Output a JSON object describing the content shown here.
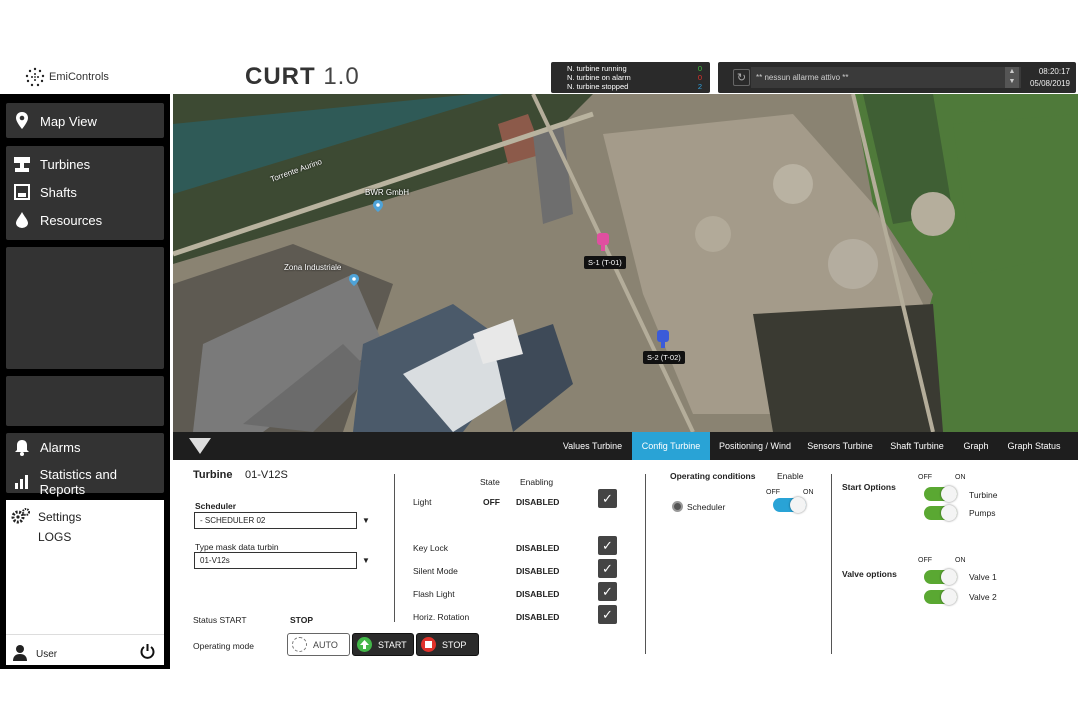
{
  "header": {
    "company": "EmiControls",
    "app_name": "CURT",
    "app_version": "1.0",
    "summary": [
      {
        "label": "N. turbine running",
        "value": "0",
        "color": "#3fbf3f"
      },
      {
        "label": "N. turbine on alarm",
        "value": "0",
        "color": "#e0322b"
      },
      {
        "label": "N. turbine stopped",
        "value": "2",
        "color": "#2fa3e0"
      }
    ],
    "alarm_text": "** nessun allarme attivo **",
    "time": "08:20:17",
    "date": "05/08/2019"
  },
  "sidebar": {
    "map_view": "Map View",
    "turbines": "Turbines",
    "shafts": "Shafts",
    "resources": "Resources",
    "alarms": "Alarms",
    "statistics": "Statistics and Reports",
    "settings": "Settings",
    "logs": "LOGS",
    "user": "User"
  },
  "map": {
    "labels": {
      "river": "Torrente Aurino",
      "bwr": "BWR GmbH",
      "zona": "Zona Industriale",
      "s1": "S-1 (T-01)",
      "s2": "S-2 (T-02)"
    }
  },
  "tabs": {
    "values_turbine": "Values Turbine",
    "config_turbine": "Config Turbine",
    "positioning_wind": "Positioning / Wind",
    "sensors_turbine": "Sensors Turbine",
    "shaft_turbine": "Shaft Turbine",
    "graph": "Graph",
    "graph_status": "Graph Status",
    "active": "Config Turbine"
  },
  "config": {
    "turbine_label": "Turbine",
    "turbine_value": "01-V12S",
    "scheduler_label": "Scheduler",
    "scheduler_value": "- SCHEDULER 02",
    "type_mask_label": "Type mask data turbin",
    "type_mask_value": "01-V12s",
    "status_label": "Status START",
    "status_value": "STOP",
    "operating_mode_label": "Operating mode",
    "buttons": {
      "auto": "AUTO",
      "start": "START",
      "stop": "STOP"
    },
    "state_header": "State",
    "enabling_header": "Enabling",
    "functions": [
      {
        "name": "Light",
        "state": "OFF",
        "enabling": "DISABLED"
      },
      {
        "name": "Key Lock",
        "state": "",
        "enabling": "DISABLED"
      },
      {
        "name": "Silent Mode",
        "state": "",
        "enabling": "DISABLED"
      },
      {
        "name": "Flash Light",
        "state": "",
        "enabling": "DISABLED"
      },
      {
        "name": "Horiz. Rotation",
        "state": "",
        "enabling": "DISABLED"
      }
    ],
    "operating_conditions": {
      "title": "Operating conditions",
      "enable_label": "Enable",
      "off": "OFF",
      "on": "ON",
      "scheduler": "Scheduler"
    },
    "start_options": {
      "title": "Start Options",
      "off": "OFF",
      "on": "ON",
      "items": [
        "Turbine",
        "Pumps"
      ]
    },
    "valve_options": {
      "title": "Valve options",
      "off": "OFF",
      "on": "ON",
      "items": [
        "Valve 1",
        "Valve 2"
      ]
    }
  }
}
